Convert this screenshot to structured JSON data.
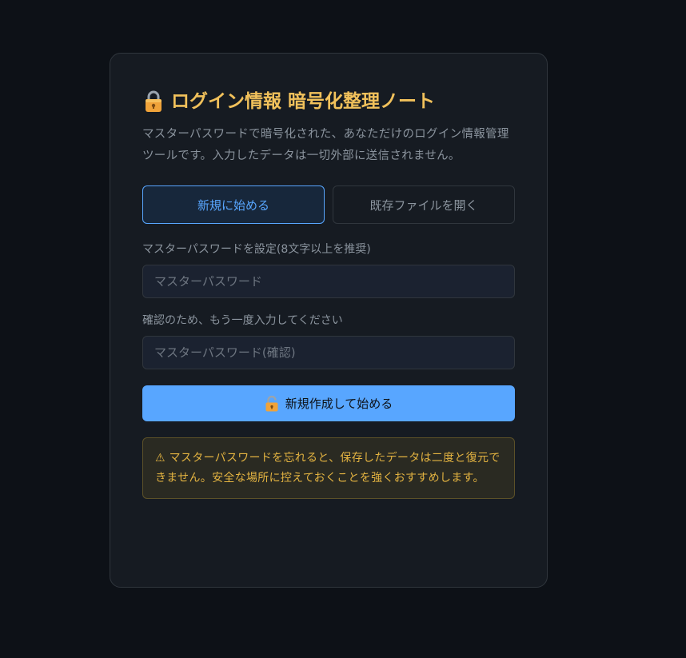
{
  "app": {
    "title": "ログイン情報 暗号化整理ノート",
    "description": "マスターパスワードで暗号化された、あなただけのログイン情報管理ツールです。入力したデータは一切外部に送信されません。"
  },
  "mode_tabs": [
    {
      "label": "新規に始める",
      "active": true
    },
    {
      "label": "既存ファイルを開く",
      "active": false
    }
  ],
  "form": {
    "password_label": "マスターパスワードを設定(8文字以上を推奨)",
    "password_placeholder": "マスターパスワード",
    "password_value": "",
    "confirm_label": "確認のため、もう一度入力してください",
    "confirm_placeholder": "マスターパスワード(確認)",
    "confirm_value": "",
    "submit_label": "新規作成して始める"
  },
  "warning": {
    "text": "⚠ マスターパスワードを忘れると、保存したデータは二度と復元できません。安全な場所に控えておくことを強くおすすめします。"
  },
  "icons": {
    "title_icon": "lock-icon",
    "submit_icon": "unlock-icon"
  },
  "colors": {
    "background": "#0d1117",
    "card": "#161b22",
    "accent": "#58a6ff",
    "title": "#f1c15b",
    "warning_text": "#e3b341"
  }
}
